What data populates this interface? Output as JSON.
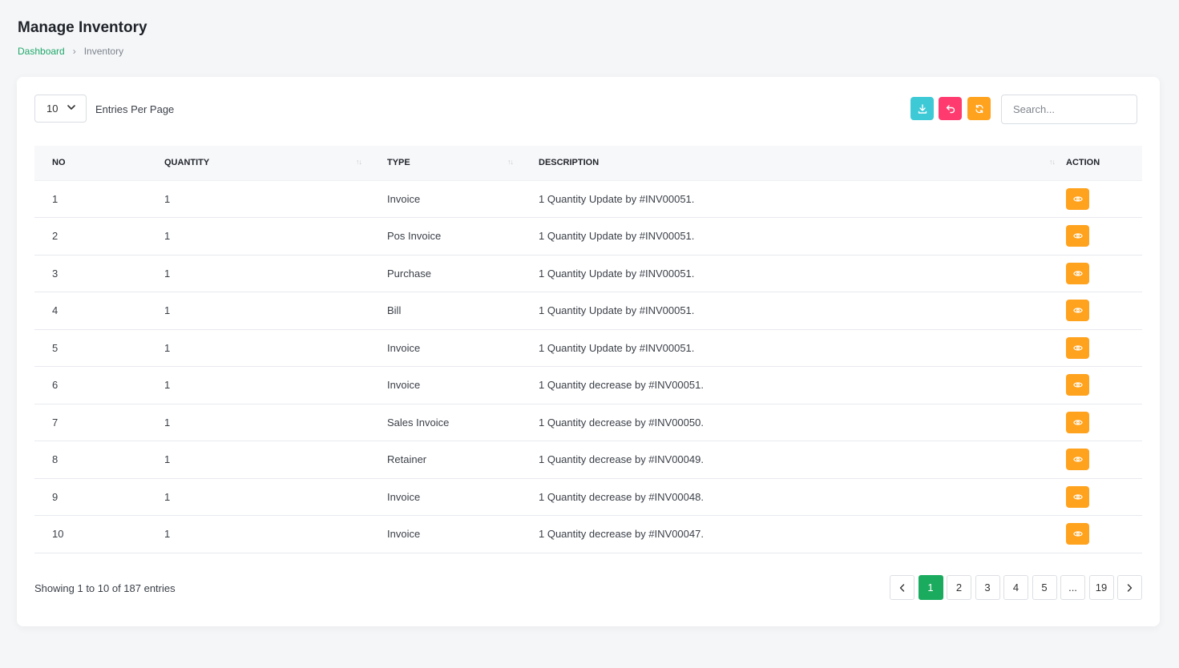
{
  "header": {
    "title": "Manage Inventory",
    "breadcrumb": {
      "home": "Dashboard",
      "current": "Inventory"
    }
  },
  "toolbar": {
    "per_page_value": "10",
    "per_page_label": "Entries Per Page",
    "search_placeholder": "Search...",
    "colors": {
      "export": "#3ec9d6",
      "back": "#ff3a6e",
      "refresh": "#ffa21d"
    }
  },
  "table": {
    "headers": {
      "no": "NO",
      "quantity": "QUANTITY",
      "type": "TYPE",
      "description": "DESCRIPTION",
      "action": "ACTION"
    },
    "rows": [
      {
        "no": "1",
        "quantity": "1",
        "type": "Invoice",
        "description": "1 Quantity Update by #INV00051."
      },
      {
        "no": "2",
        "quantity": "1",
        "type": "Pos Invoice",
        "description": "1 Quantity Update by #INV00051."
      },
      {
        "no": "3",
        "quantity": "1",
        "type": "Purchase",
        "description": "1 Quantity Update by #INV00051."
      },
      {
        "no": "4",
        "quantity": "1",
        "type": "Bill",
        "description": "1 Quantity Update by #INV00051."
      },
      {
        "no": "5",
        "quantity": "1",
        "type": "Invoice",
        "description": "1 Quantity Update by #INV00051."
      },
      {
        "no": "6",
        "quantity": "1",
        "type": "Invoice",
        "description": "1 Quantity decrease by #INV00051."
      },
      {
        "no": "7",
        "quantity": "1",
        "type": "Sales Invoice",
        "description": "1 Quantity decrease by #INV00050."
      },
      {
        "no": "8",
        "quantity": "1",
        "type": "Retainer",
        "description": "1 Quantity decrease by #INV00049."
      },
      {
        "no": "9",
        "quantity": "1",
        "type": "Invoice",
        "description": "1 Quantity decrease by #INV00048."
      },
      {
        "no": "10",
        "quantity": "1",
        "type": "Invoice",
        "description": "1 Quantity decrease by #INV00047."
      }
    ],
    "action_icon": "eye-icon",
    "action_color": "#ffa21d"
  },
  "footer": {
    "showing": "Showing 1 to 10 of 187 entries",
    "pages": [
      "1",
      "2",
      "3",
      "4",
      "5",
      "...",
      "19"
    ],
    "current_page": "1",
    "active_color": "#1bab5e"
  }
}
